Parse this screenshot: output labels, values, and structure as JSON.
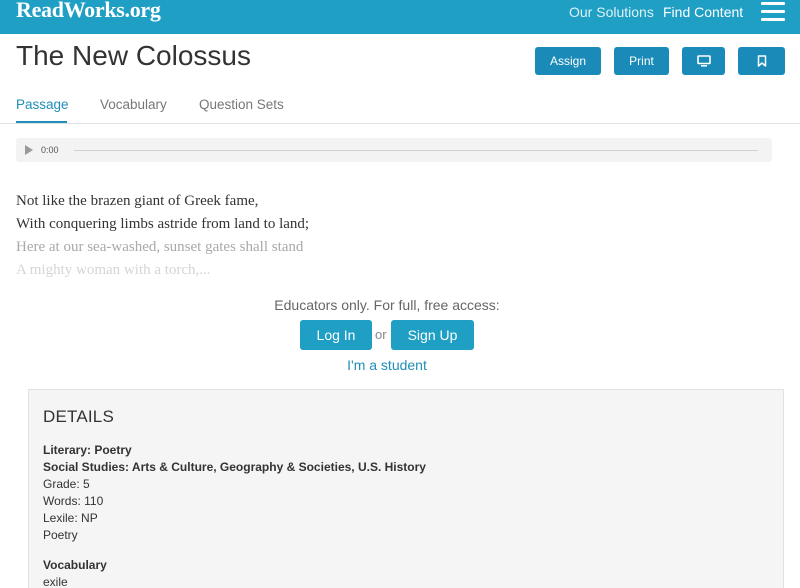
{
  "header": {
    "logo": "ReadWorks.org",
    "nav": {
      "solutions": "Our Solutions",
      "find": "Find Content"
    }
  },
  "page": {
    "title": "The New Colossus",
    "buttons": {
      "assign": "Assign",
      "print": "Print"
    }
  },
  "tabs": [
    {
      "label": "Passage"
    },
    {
      "label": "Vocabulary"
    },
    {
      "label": "Question Sets"
    }
  ],
  "audio": {
    "time": "0:00",
    "progress": 0
  },
  "passage": {
    "lines": [
      "Not like the brazen giant of Greek fame,",
      "With conquering limbs astride from land to land;",
      "Here at our sea-washed, sunset gates shall stand",
      "A mighty woman with a torch,..."
    ]
  },
  "access": {
    "message": "Educators only. For full, free access:",
    "login": "Log In",
    "or": "or",
    "signup": "Sign Up",
    "student": "I'm a student"
  },
  "details": {
    "title": "DETAILS",
    "literary": "Literary: Poetry",
    "social_studies": "Social Studies: Arts & Culture, Geography & Societies, U.S. History",
    "grade": "Grade: 5",
    "words": "Words: 110",
    "lexile": "Lexile: NP",
    "genre": "Poetry",
    "vocab_heading": "Vocabulary",
    "vocab_first": "exile"
  },
  "colors": {
    "brand": "#1f9fc4",
    "button": "#1a8ab8",
    "link": "#1f8fb8"
  }
}
